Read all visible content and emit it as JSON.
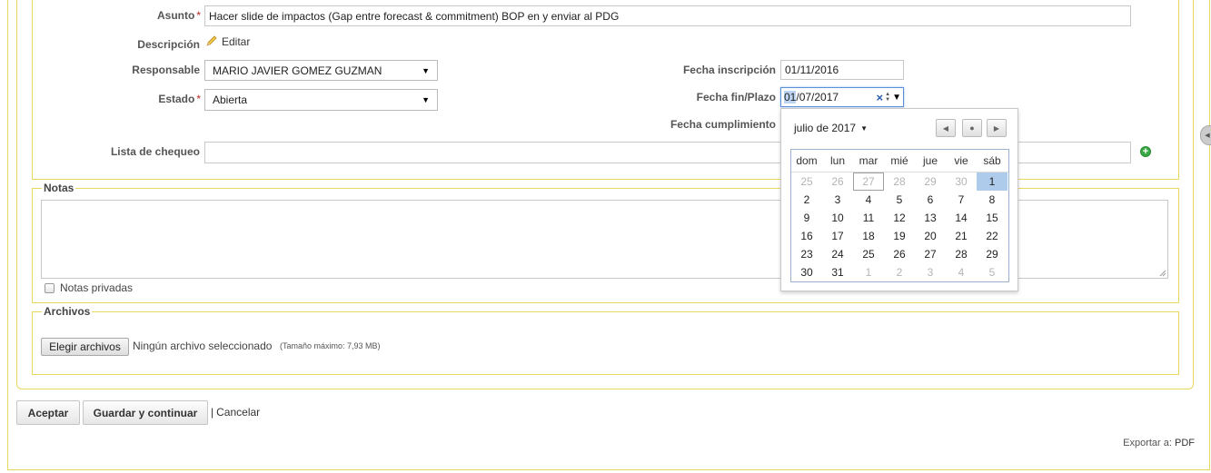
{
  "form": {
    "asunto_label": "Asunto",
    "asunto_value": "Hacer slide de impactos (Gap entre forecast & commitment) BOP en y enviar al PDG",
    "descripcion_label": "Descripción",
    "editar_link": "Editar",
    "responsable_label": "Responsable",
    "responsable_value": "MARIO JAVIER GOMEZ GUZMAN",
    "estado_label": "Estado",
    "estado_value": "Abierta",
    "fecha_inscripcion_label": "Fecha inscripción",
    "fecha_inscripcion_value": "01/11/2016",
    "fecha_fin_label": "Fecha fin/Plazo",
    "fecha_fin_day": "01",
    "fecha_fin_rest": "/07/2017",
    "fecha_cumplimiento_label": "Fecha cumplimiento",
    "lista_chequeo_label": "Lista de chequeo",
    "required_mark": "*"
  },
  "datepicker": {
    "month_label": "julio de 2017",
    "weekdays": [
      "dom",
      "lun",
      "mar",
      "mié",
      "jue",
      "vie",
      "sáb"
    ],
    "weeks": [
      [
        "25",
        "26",
        "27",
        "28",
        "29",
        "30",
        "1"
      ],
      [
        "2",
        "3",
        "4",
        "5",
        "6",
        "7",
        "8"
      ],
      [
        "9",
        "10",
        "11",
        "12",
        "13",
        "14",
        "15"
      ],
      [
        "16",
        "17",
        "18",
        "19",
        "20",
        "21",
        "22"
      ],
      [
        "23",
        "24",
        "25",
        "26",
        "27",
        "28",
        "29"
      ],
      [
        "30",
        "31",
        "1",
        "2",
        "3",
        "4",
        "5"
      ]
    ]
  },
  "notas": {
    "legend": "Notas",
    "private_label": "Notas privadas",
    "private_checked": false
  },
  "archivos": {
    "legend": "Archivos",
    "choose_button": "Elegir archivos",
    "no_file_text": "Ningún archivo seleccionado",
    "max_size_text": "(Tamaño máximo: 7,93 MB)"
  },
  "actions": {
    "accept": "Aceptar",
    "save_continue": "Guardar y continuar",
    "separator": "|",
    "cancel": "Cancelar"
  },
  "footer": {
    "export_label": "Exportar a:",
    "pdf_link": "PDF"
  },
  "colors": {
    "frame": "#e8d85c",
    "selected_day": "#aecbeb",
    "add_icon": "#3aa845"
  }
}
